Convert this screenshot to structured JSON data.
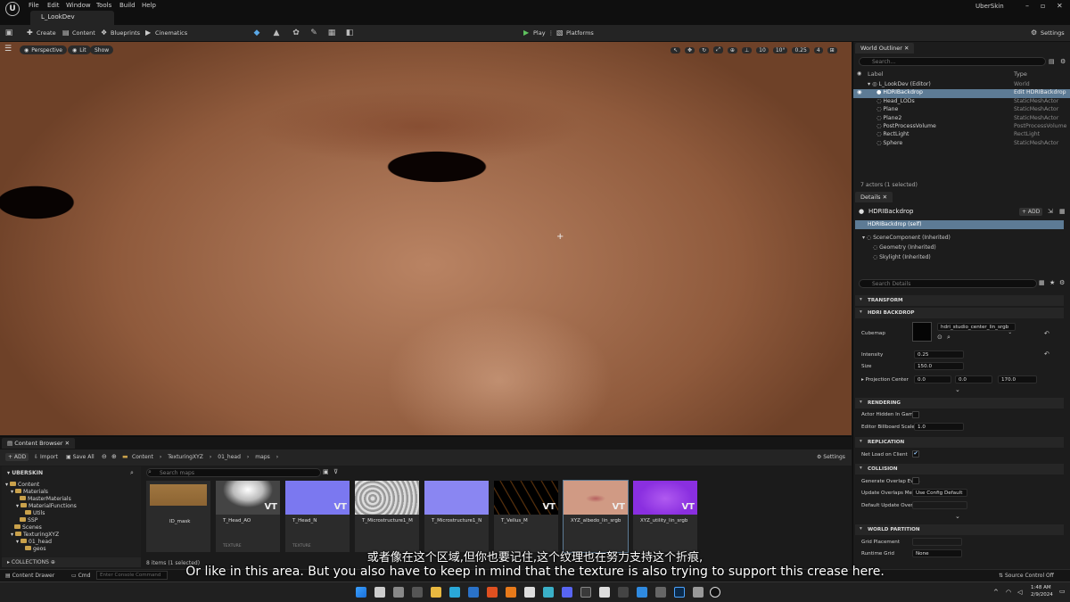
{
  "titlebar": {
    "menus": [
      "File",
      "Edit",
      "Window",
      "Tools",
      "Build",
      "Help"
    ],
    "level_tab": "L_LookDev",
    "project_name": "UberSkin",
    "logo": "unreal-logo"
  },
  "toolbar": {
    "create": "Create",
    "content": "Content",
    "blueprints": "Blueprints",
    "cinematics": "Cinematics",
    "play": "Play",
    "platforms": "Platforms",
    "settings": "Settings"
  },
  "viewport": {
    "perspective": "Perspective",
    "lit": "Lit",
    "show": "Show",
    "grid_snap": "10",
    "rotation_snap": "10°",
    "scale_snap": "0.25",
    "camera_speed": "4"
  },
  "outliner": {
    "tab": "World Outliner",
    "search_placeholder": "Search...",
    "col_label": "Label",
    "col_type": "Type",
    "rows": [
      {
        "label": "L_LookDev (Editor)",
        "type": "World"
      },
      {
        "label": "HDRIBackdrop",
        "type": "Edit HDRIBackdrop"
      },
      {
        "label": "Head_LODs",
        "type": "StaticMeshActor"
      },
      {
        "label": "Plane",
        "type": "StaticMeshActor"
      },
      {
        "label": "Plane2",
        "type": "StaticMeshActor"
      },
      {
        "label": "PostProcessVolume",
        "type": "PostProcessVolume"
      },
      {
        "label": "RectLight",
        "type": "RectLight"
      },
      {
        "label": "Sphere",
        "type": "StaticMeshActor"
      }
    ],
    "status": "7 actors (1 selected)"
  },
  "details": {
    "tab": "Details",
    "actor_name": "HDRIBackdrop",
    "add": "+ ADD",
    "components": [
      "HDRIBackdrop (self)",
      "SceneComponent (Inherited)",
      "Geometry (Inherited)",
      "Skylight (Inherited)"
    ],
    "search_placeholder": "Search Details",
    "sections": {
      "transform": "TRANSFORM",
      "hdri_backdrop": "HDRI BACKDROP",
      "rendering": "RENDERING",
      "replication": "REPLICATION",
      "collision": "COLLISION",
      "world_partition": "WORLD PARTITION"
    },
    "props": {
      "cubemap_label": "Cubemap",
      "cubemap_value": "hdri_studio_center_lin_srgb",
      "intensity_label": "Intensity",
      "intensity_value": "0.25",
      "size_label": "Size",
      "size_value": "150.0",
      "projection_label": "Projection Center",
      "proj_x": "0.0",
      "proj_y": "0.0",
      "proj_z": "170.0",
      "hidden_label": "Actor Hidden In Game",
      "billboard_label": "Editor Billboard Scale",
      "billboard_value": "1.0",
      "net_load_label": "Net Load on Client",
      "overlap_label": "Generate Overlap Even",
      "update_overlap_label": "Update Overlaps Meth",
      "update_overlap_value": "Use Config Default",
      "default_update_label": "Default Update Overlap",
      "grid_placement_label": "Grid Placement",
      "runtime_grid_label": "Runtime Grid",
      "runtime_grid_value": "None"
    }
  },
  "content_browser": {
    "tab": "Content Browser",
    "add": "+ ADD",
    "import": "Import",
    "save_all": "Save All",
    "breadcrumb": [
      "Content",
      "TexturingXYZ",
      "01_head",
      "maps"
    ],
    "settings": "Settings",
    "project_root": "UBERSKIN",
    "tree": [
      "Content",
      "Materials",
      "MasterMaterials",
      "MaterialFunctions",
      "Utils",
      "SSP",
      "Scenes",
      "TexturingXYZ",
      "01_head",
      "geos"
    ],
    "collections": "COLLECTIONS",
    "search_placeholder": "Search maps",
    "assets": [
      {
        "name": "ID_mask",
        "type": ""
      },
      {
        "name": "T_Head_AO",
        "type": "TEXTURE"
      },
      {
        "name": "T_Head_N",
        "type": "TEXTURE"
      },
      {
        "name": "T_Microstructure1_M",
        "type": ""
      },
      {
        "name": "T_Microstructure1_N",
        "type": ""
      },
      {
        "name": "T_Vellus_M",
        "type": ""
      },
      {
        "name": "XYZ_albedo_lin_srgb",
        "type": ""
      },
      {
        "name": "XYZ_utility_lin_srgb",
        "type": ""
      }
    ],
    "vt_badge": "VT",
    "items_status": "8 items (1 selected)"
  },
  "statusbar": {
    "content_drawer": "Content Drawer",
    "cmd": "Cmd",
    "console_placeholder": "Enter Console Command",
    "source_control": "Source Control Off"
  },
  "subtitles": {
    "cn": "或者像在这个区域,但你也要记住,这个纹理也在努力支持这个折痕,",
    "en": "Or like in this area. But you also have to keep in mind that the texture is also trying to support this crease here."
  },
  "taskbar": {
    "time": "1:48 AM",
    "date": "2/9/2024"
  }
}
